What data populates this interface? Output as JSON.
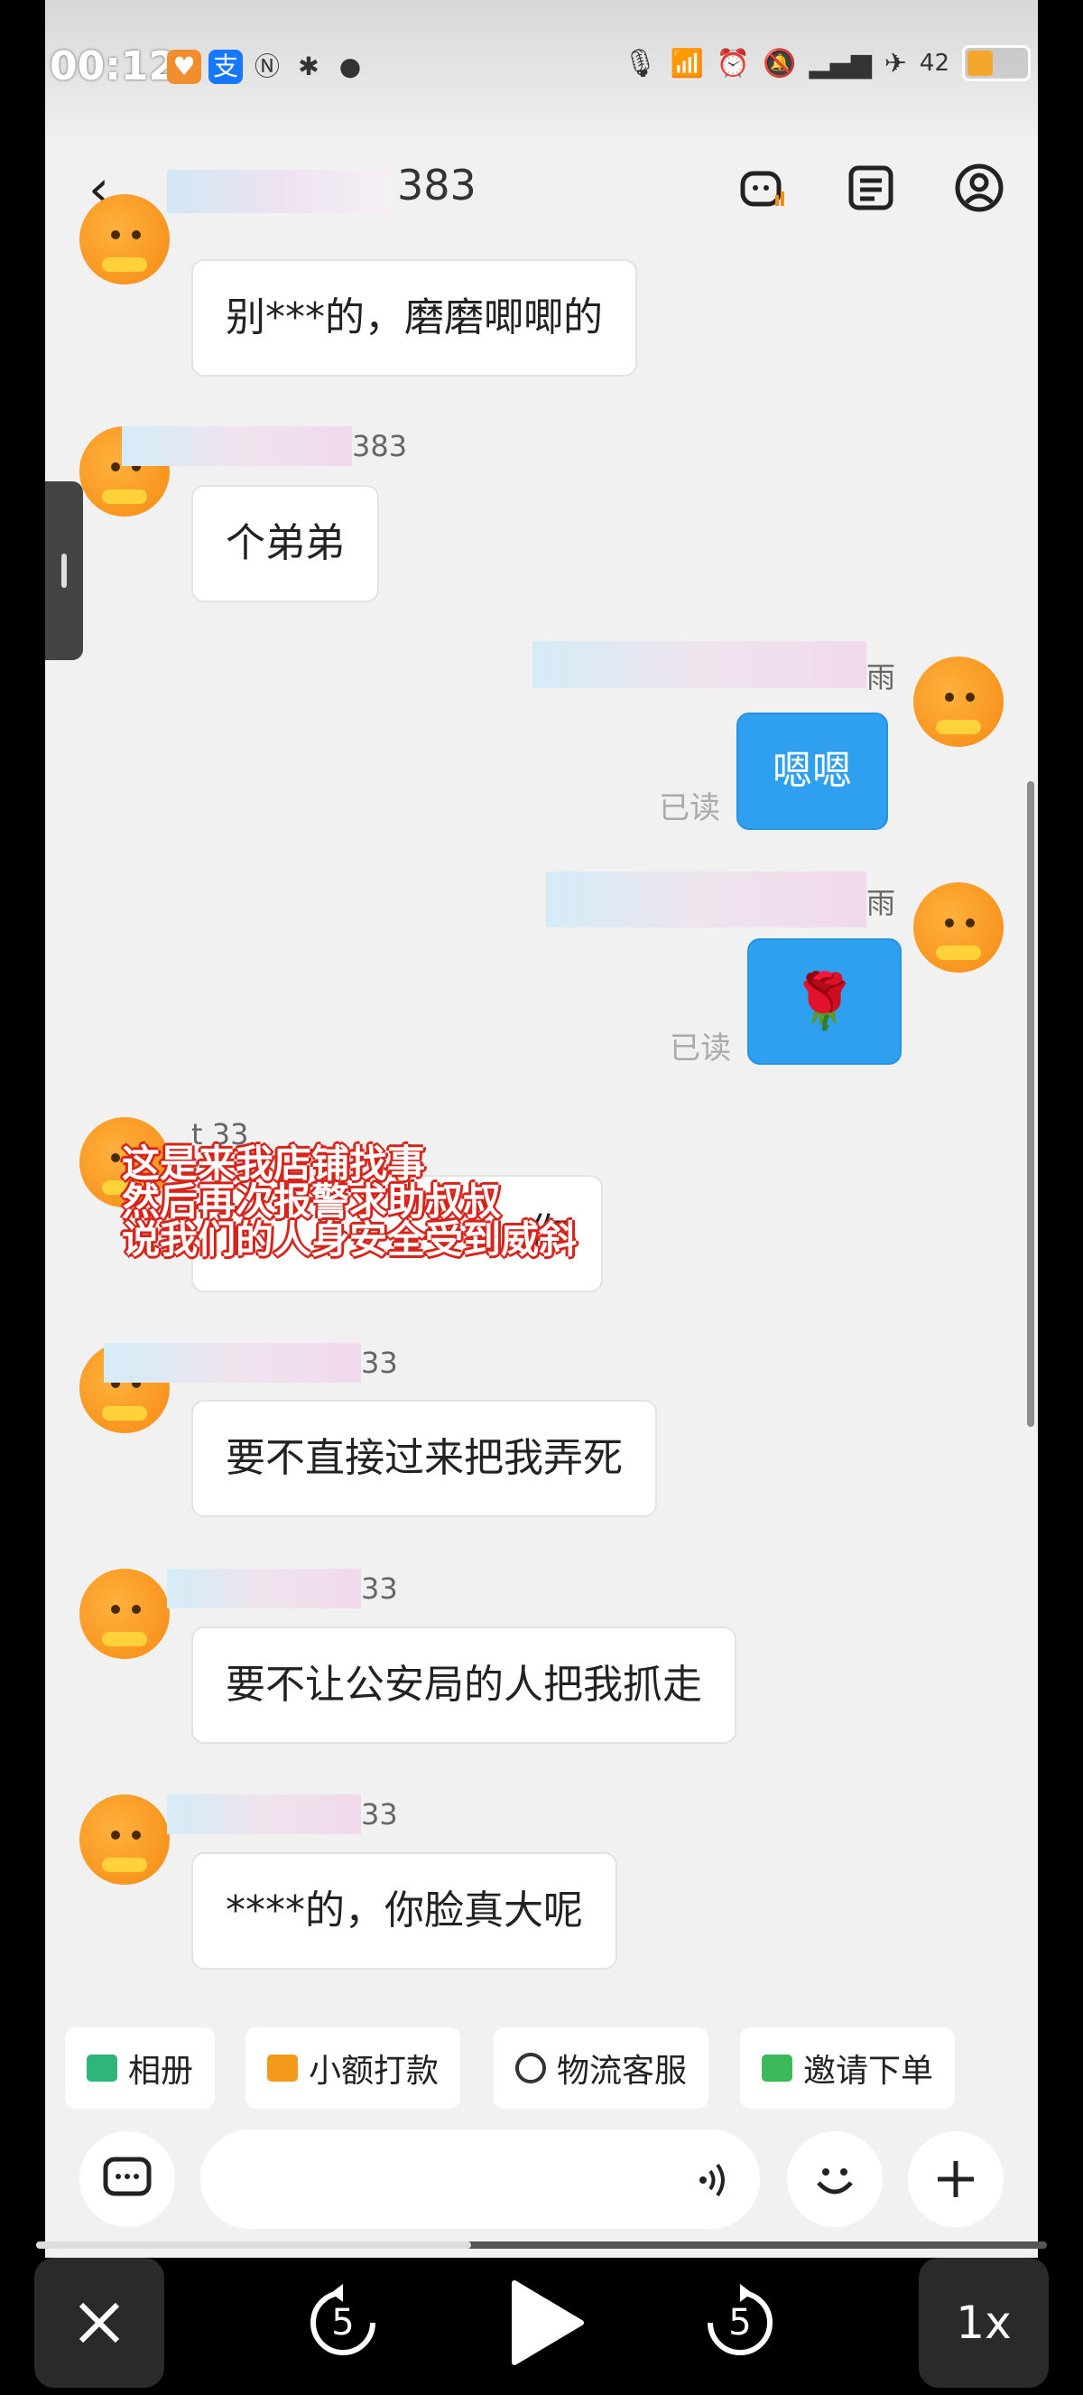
{
  "status_bar": {
    "time": "00:12",
    "battery_level": "42",
    "icons": [
      "heart-app-icon",
      "alipay-icon",
      "nfc-icon",
      "bluetooth-icon",
      "location-icon",
      "mic-icon",
      "wifi-icon",
      "alarm-icon",
      "mute-icon",
      "signal-icon",
      "airplane-icon",
      "battery-icon"
    ],
    "alipay_label": "支"
  },
  "header": {
    "back_icon": "back-icon",
    "title_suffix": "383",
    "icons": [
      "robot-icon",
      "notes-icon",
      "profile-icon"
    ]
  },
  "messages": [
    {
      "side": "left",
      "name": "",
      "text": "别***的，磨磨唧唧的"
    },
    {
      "side": "left",
      "name": "383",
      "text": "个弟弟"
    },
    {
      "side": "right",
      "name": "雨",
      "text": "嗯嗯",
      "read": "已读"
    },
    {
      "side": "right",
      "name": "雨",
      "text": "🌹",
      "read": "已读"
    },
    {
      "side": "left",
      "name": "t          33",
      "text": "你"
    },
    {
      "side": "left",
      "name": "33",
      "text": "要不直接过来把我弄死"
    },
    {
      "side": "left",
      "name": "33",
      "text": "要不让公安局的人把我抓走"
    },
    {
      "side": "left",
      "name": "33",
      "text": "****的，你脸真大呢"
    }
  ],
  "overlay_caption": [
    "这是来我店铺找事",
    "然后再次报警求助叔叔",
    "说我们的人身安全受到威斜"
  ],
  "quick_actions": [
    {
      "label": "相册",
      "icon": "album-icon",
      "color": "#2fb47a"
    },
    {
      "label": "小额打款",
      "icon": "payment-icon",
      "color": "#f39a1b"
    },
    {
      "label": "物流客服",
      "icon": "logistics-service-icon",
      "color": "#333333"
    },
    {
      "label": "邀请下单",
      "icon": "invite-order-icon",
      "color": "#3cb95a"
    }
  ],
  "input_bar": {
    "placeholder": "",
    "icons": [
      "chat-icon",
      "voice-icon",
      "emoji-icon",
      "plus-icon"
    ]
  },
  "player": {
    "speed": "1x",
    "rewind_seconds": "5",
    "forward_seconds": "5",
    "progress": 0.43
  },
  "colors": {
    "accent": "#2f9ff0",
    "overlay_stroke": "#d8231a",
    "avatar": "#f58a14"
  }
}
